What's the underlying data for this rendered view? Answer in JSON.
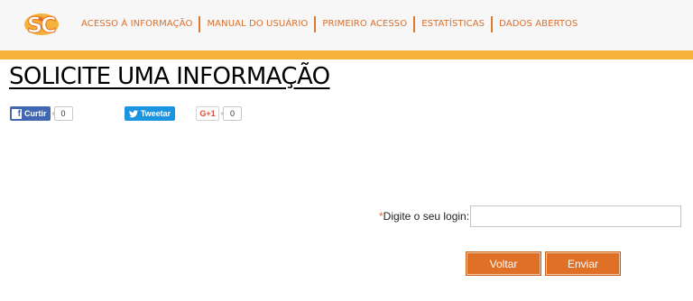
{
  "header": {
    "nav": [
      {
        "label": "ACESSO À INFORMAÇÃO"
      },
      {
        "label": "MANUAL DO USUÁRIO"
      },
      {
        "label": "PRIMEIRO ACESSO"
      },
      {
        "label": "ESTATÍSTICAS"
      },
      {
        "label": "DADOS ABERTOS"
      }
    ]
  },
  "colors": {
    "accent": "#e07026",
    "nav_text": "#d9702d",
    "stripe": "#f6b23a",
    "facebook": "#4267b2",
    "twitter": "#1b95e0"
  },
  "page_title": "SOLICITE UMA INFORMAÇÃO",
  "social": {
    "facebook": {
      "label": "Curtir",
      "count": "0",
      "icon": "facebook-icon"
    },
    "twitter": {
      "label": "Tweetar",
      "icon": "twitter-bird-icon"
    },
    "gplus": {
      "label": "G+1",
      "count": "0"
    }
  },
  "form": {
    "required_mark": "*",
    "login_label": "Digite o seu login:",
    "login_value": "",
    "back_button": "Voltar",
    "send_button": "Enviar"
  }
}
